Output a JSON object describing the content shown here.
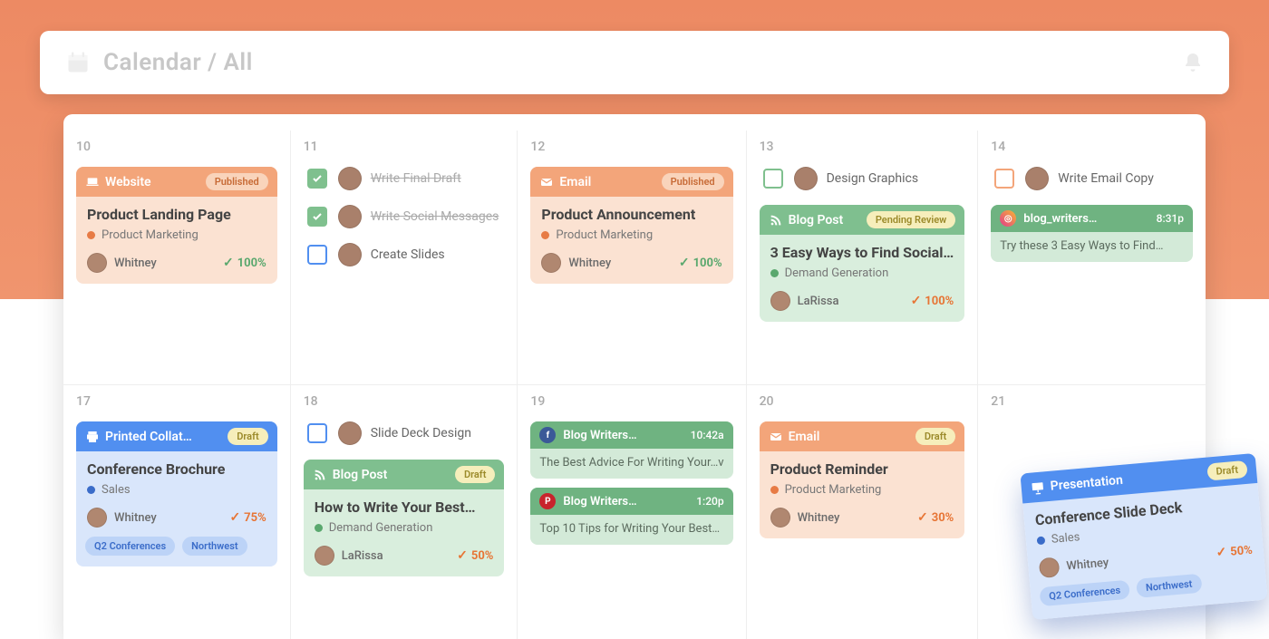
{
  "header": {
    "title": "Calendar / All"
  },
  "colors": {
    "orange_dot": "#e77b45",
    "green_dot": "#5aa86e",
    "blue_dot": "#3a6cc9"
  },
  "badges": {
    "published": "Published",
    "draft": "Draft",
    "pending": "Pending Review"
  },
  "days": [
    "10",
    "11",
    "12",
    "13",
    "14",
    "17",
    "18",
    "19",
    "20",
    "21"
  ],
  "c10": {
    "type": "Website",
    "title": "Product Landing Page",
    "category": "Product Marketing",
    "owner": "Whitney",
    "pct": "100%",
    "status": "Published"
  },
  "c11": {
    "t1": "Write Final Draft",
    "t2": "Write Social Messages",
    "t3": "Create Slides"
  },
  "c12": {
    "type": "Email",
    "title": "Product Announcement",
    "category": "Product Marketing",
    "owner": "Whitney",
    "pct": "100%",
    "status": "Published"
  },
  "c13": {
    "task": "Design Graphics",
    "type": "Blog Post",
    "title": "3 Easy Ways to Find Social…",
    "category": "Demand Generation",
    "owner": "LaRissa",
    "pct": "100%",
    "status": "Pending Review"
  },
  "c14": {
    "task": "Write Email Copy",
    "social_handle": "blog_writers…",
    "social_time": "8:31p",
    "social_body": "Try these 3 Easy Ways to Find…"
  },
  "c17": {
    "type": "Printed Collat…",
    "title": "Conference Brochure",
    "category": "Sales",
    "owner": "Whitney",
    "pct": "75%",
    "status": "Draft",
    "chips": [
      "Q2 Conferences",
      "Northwest"
    ]
  },
  "c18": {
    "task": "Slide Deck Design",
    "type": "Blog Post",
    "title": "How to Write Your Best…",
    "category": "Demand Generation",
    "owner": "LaRissa",
    "pct": "50%",
    "status": "Draft"
  },
  "c19": {
    "s1_handle": "Blog Writers…",
    "s1_time": "10:42a",
    "s1_body": "The Best Advice For Writing Your…v",
    "s2_handle": "Blog Writers…",
    "s2_time": "1:20p",
    "s2_body": "Top 10 Tips for Writing Your Best…"
  },
  "c20": {
    "type": "Email",
    "title": "Product Reminder",
    "category": "Product Marketing",
    "owner": "Whitney",
    "pct": "30%",
    "status": "Draft"
  },
  "float": {
    "type": "Presentation",
    "title": "Conference Slide Deck",
    "category": "Sales",
    "owner": "Whitney",
    "pct": "50%",
    "status": "Draft",
    "chips": [
      "Q2 Conferences",
      "Northwest"
    ]
  }
}
